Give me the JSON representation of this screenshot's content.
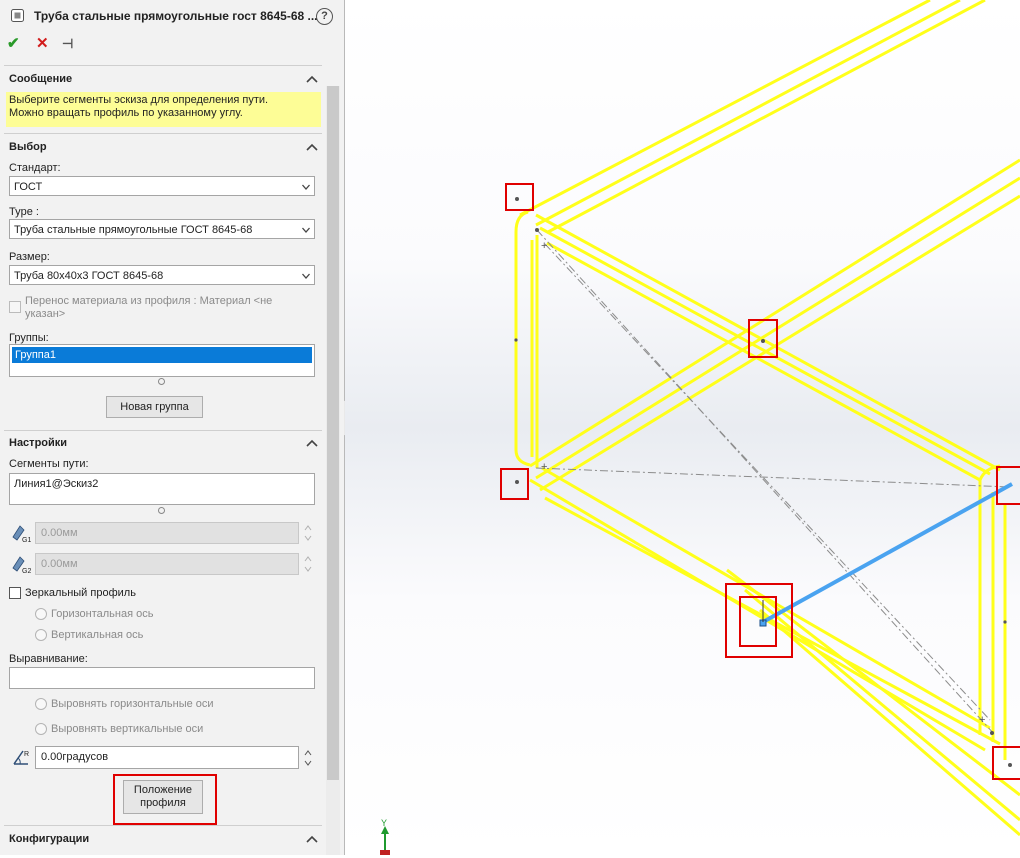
{
  "window": {
    "title": "Труба стальные прямоугольные гост 8645-68 ...",
    "help_label": "?"
  },
  "actions": {
    "ok_icon": "checkmark-icon",
    "cancel_icon": "x-icon",
    "pin_icon": "pushpin-icon"
  },
  "message": {
    "header": "Сообщение",
    "text": "Выберите сегменты эскиза для определения пути.\nМожно вращать профиль по указанному углу."
  },
  "selection": {
    "header": "Выбор",
    "standard_label": "Стандарт:",
    "standard_value": "ГОСТ",
    "type_label": "Type :",
    "type_value": "Труба стальные прямоугольные ГОСТ 8645-68",
    "size_label": "Размер:",
    "size_value": "Труба 80x40x3 ГОСТ 8645-68",
    "transfer_material_label": "Перенос материала из профиля : Материал <не\nуказан>",
    "transfer_material_checked": false,
    "groups_label": "Группы:",
    "groups": [
      "Группа1"
    ],
    "new_group_button": "Новая группа"
  },
  "settings": {
    "header": "Настройки",
    "path_segments_label": "Сегменты пути:",
    "path_segments": [
      "Линия1@Эскиз2"
    ],
    "gap1_value": "0.00мм",
    "gap2_value": "0.00мм",
    "mirror_profile_label": "Зеркальный профиль",
    "mirror_profile_checked": false,
    "horizontal_axis_label": "Горизонтальная ось",
    "vertical_axis_label": "Вертикальная ось",
    "alignment_label": "Выравнивание:",
    "alignment_value": "",
    "align_horizontal_label": "Выровнять горизонтальные оси",
    "align_vertical_label": "Выровнять вертикальные оси",
    "rotation_value": "0.00градусов",
    "locate_profile_button": "Положение\nпрофиля"
  },
  "configurations": {
    "header": "Конфигурации"
  },
  "viewport": {
    "frame_color": "#ffff1a",
    "path_color": "#4aa3f0",
    "highlight_color": "#e00000",
    "triad_label": "Y"
  }
}
